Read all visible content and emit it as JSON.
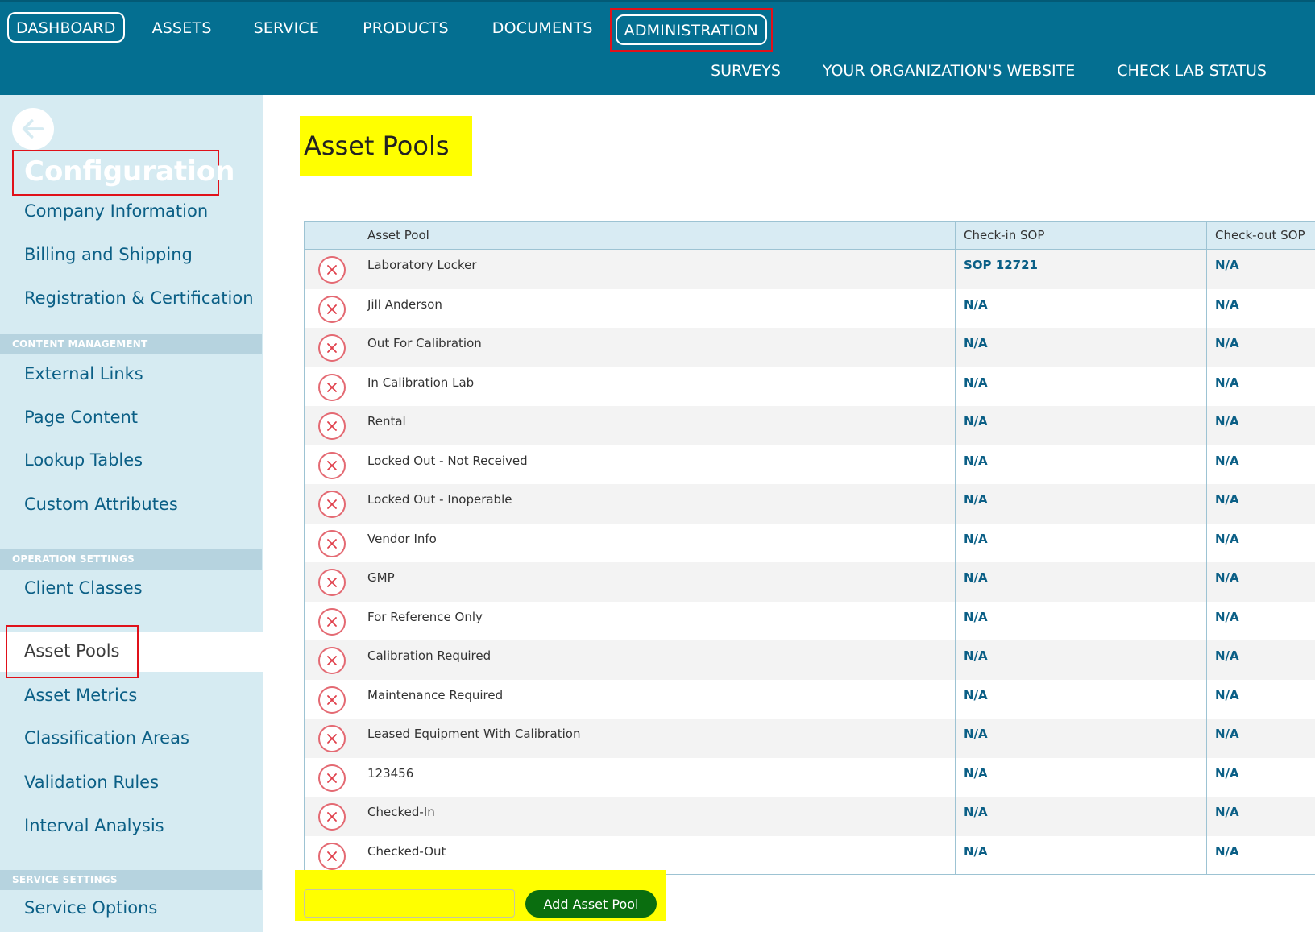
{
  "topnav": {
    "items": [
      "DASHBOARD",
      "ASSETS",
      "SERVICE",
      "PRODUCTS",
      "DOCUMENTS"
    ],
    "active": "ADMINISTRATION",
    "secondary": [
      "SURVEYS",
      "YOUR ORGANIZATION'S WEBSITE",
      "CHECK LAB STATUS"
    ]
  },
  "sidebar": {
    "title": "Configuration",
    "group1": [
      "Company Information",
      "Billing and Shipping",
      "Registration & Certification"
    ],
    "content_management": {
      "heading": "CONTENT MANAGEMENT",
      "items": [
        "External Links",
        "Page Content",
        "Lookup Tables",
        "Custom Attributes"
      ]
    },
    "operation_settings": {
      "heading": "OPERATION SETTINGS",
      "items": [
        "Client Classes",
        "Asset Pools",
        "Asset Metrics",
        "Classification Areas",
        "Validation Rules",
        "Interval Analysis"
      ],
      "active": "Asset Pools"
    },
    "service_settings": {
      "heading": "SERVICE SETTINGS",
      "items": [
        "Service Options"
      ]
    }
  },
  "main": {
    "title": "Asset Pools",
    "columns": [
      "Asset Pool",
      "Check-in SOP",
      "Check-out SOP"
    ],
    "rows": [
      [
        "Laboratory Locker",
        "SOP 12721",
        "N/A"
      ],
      [
        "Jill Anderson",
        "N/A",
        "N/A"
      ],
      [
        "Out For Calibration",
        "N/A",
        "N/A"
      ],
      [
        "In Calibration Lab",
        "N/A",
        "N/A"
      ],
      [
        "Rental",
        "N/A",
        "N/A"
      ],
      [
        "Locked Out - Not Received",
        "N/A",
        "N/A"
      ],
      [
        "Locked Out - Inoperable",
        "N/A",
        "N/A"
      ],
      [
        "Vendor Info",
        "N/A",
        "N/A"
      ],
      [
        "GMP",
        "N/A",
        "N/A"
      ],
      [
        "For Reference Only",
        "N/A",
        "N/A"
      ],
      [
        "Calibration Required",
        "N/A",
        "N/A"
      ],
      [
        "Maintenance Required",
        "N/A",
        "N/A"
      ],
      [
        "Leased Equipment With Calibration",
        "N/A",
        "N/A"
      ],
      [
        "123456",
        "N/A",
        "N/A"
      ],
      [
        "Checked-In",
        "N/A",
        "N/A"
      ],
      [
        "Checked-Out",
        "N/A",
        "N/A"
      ]
    ],
    "add": {
      "input_value": "",
      "button_label": "Add Asset Pool"
    }
  },
  "colors": {
    "nav_bg": "#046f91",
    "sidebar_bg": "#d6ebf2",
    "link": "#0b5f86",
    "highlight": "#ffff00",
    "outline": "#e0111a",
    "add_button": "#0a6e0f"
  }
}
